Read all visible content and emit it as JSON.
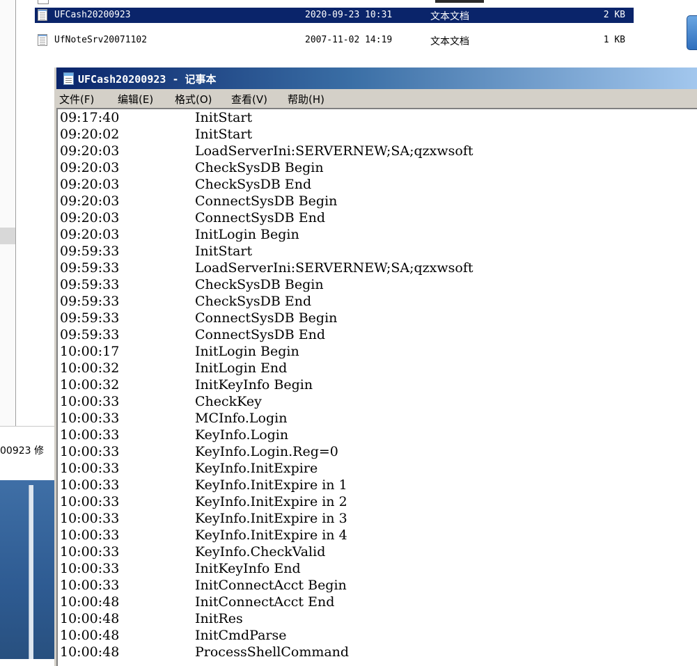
{
  "explorer": {
    "files": [
      {
        "name": "UFCash20200923",
        "date": "2020-09-23 10:31",
        "type": "文本文档",
        "size": "2 KB",
        "selected": true
      },
      {
        "name": "UfNoteSrv20071102",
        "date": "2007-11-02 14:19",
        "type": "文本文档",
        "size": "1 KB",
        "selected": false
      }
    ],
    "status_text": "00923 修"
  },
  "notepad": {
    "title": "UFCash20200923 - 记事本",
    "menu": [
      "文件(F)",
      "编辑(E)",
      "格式(O)",
      "查看(V)",
      "帮助(H)"
    ],
    "lines": [
      {
        "time": "09:17:40",
        "msg": "InitStart"
      },
      {
        "time": "09:20:02",
        "msg": "InitStart"
      },
      {
        "time": "09:20:03",
        "msg": "LoadServerIni:SERVERNEW;SA;qzxwsoft"
      },
      {
        "time": "09:20:03",
        "msg": "CheckSysDB Begin"
      },
      {
        "time": "09:20:03",
        "msg": "CheckSysDB End"
      },
      {
        "time": "09:20:03",
        "msg": "ConnectSysDB Begin"
      },
      {
        "time": "09:20:03",
        "msg": "ConnectSysDB End"
      },
      {
        "time": "09:20:03",
        "msg": "InitLogin Begin"
      },
      {
        "time": "09:59:33",
        "msg": "InitStart"
      },
      {
        "time": "09:59:33",
        "msg": "LoadServerIni:SERVERNEW;SA;qzxwsoft"
      },
      {
        "time": "09:59:33",
        "msg": "CheckSysDB Begin"
      },
      {
        "time": "09:59:33",
        "msg": "CheckSysDB End"
      },
      {
        "time": "09:59:33",
        "msg": "ConnectSysDB Begin"
      },
      {
        "time": "09:59:33",
        "msg": "ConnectSysDB End"
      },
      {
        "time": "10:00:17",
        "msg": "InitLogin Begin"
      },
      {
        "time": "10:00:32",
        "msg": "InitLogin End"
      },
      {
        "time": "10:00:32",
        "msg": "InitKeyInfo Begin"
      },
      {
        "time": "10:00:33",
        "msg": "CheckKey"
      },
      {
        "time": "10:00:33",
        "msg": "MCInfo.Login"
      },
      {
        "time": "10:00:33",
        "msg": "KeyInfo.Login"
      },
      {
        "time": "10:00:33",
        "msg": "KeyInfo.Login.Reg=0"
      },
      {
        "time": "10:00:33",
        "msg": "KeyInfo.InitExpire"
      },
      {
        "time": "10:00:33",
        "msg": "KeyInfo.InitExpire in 1"
      },
      {
        "time": "10:00:33",
        "msg": "KeyInfo.InitExpire in 2"
      },
      {
        "time": "10:00:33",
        "msg": "KeyInfo.InitExpire in 3"
      },
      {
        "time": "10:00:33",
        "msg": "KeyInfo.InitExpire in 4"
      },
      {
        "time": "10:00:33",
        "msg": "KeyInfo.CheckValid"
      },
      {
        "time": "10:00:33",
        "msg": "InitKeyInfo End"
      },
      {
        "time": "10:00:33",
        "msg": "InitConnectAcct Begin"
      },
      {
        "time": "10:00:48",
        "msg": "InitConnectAcct End"
      },
      {
        "time": "10:00:48",
        "msg": "InitRes"
      },
      {
        "time": "10:00:48",
        "msg": "InitCmdParse"
      },
      {
        "time": "10:00:48",
        "msg": "ProcessShellCommand"
      }
    ]
  },
  "icons": {
    "file": "text-file-icon",
    "notepad": "notepad-icon"
  },
  "colors": {
    "selection": "#0a246a",
    "titlebar_start": "#0a246a",
    "titlebar_end": "#a6caf0",
    "menubar": "#d4d0c8"
  }
}
